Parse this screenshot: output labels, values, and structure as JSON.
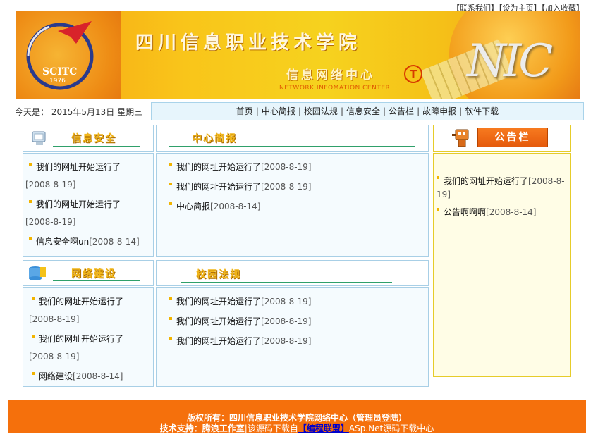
{
  "top_links": {
    "contact": "【联系我们】",
    "homepage": "【设为主页】",
    "favorite": "【加入收藏】"
  },
  "banner": {
    "title": "四川信息职业技术学院",
    "subtitle": "信息网络中心",
    "english": "NETWORK INFOMATION CENTER",
    "logo_text": "SCITC",
    "logo_year": "1976",
    "nic": "NIC",
    "t_mark": "T"
  },
  "date_bar": {
    "label": "今天是：",
    "date": "2015年5月13日 星期三"
  },
  "nav": {
    "items": [
      "首页",
      "中心简报",
      "校园法规",
      "信息安全",
      "公告栏",
      "故障申报",
      "软件下载"
    ],
    "separator": "|"
  },
  "panels": {
    "security": {
      "title": "信息安全",
      "items": [
        {
          "text": "我们的网址开始运行了",
          "date": "[2008-8-19]"
        },
        {
          "text": "我们的网址开始运行了",
          "date": "[2008-8-19]"
        },
        {
          "text": "信息安全啊un",
          "date": "[2008-8-14]"
        }
      ]
    },
    "briefing": {
      "title": "中心简报",
      "items": [
        {
          "text": "我们的网址开始运行了",
          "date": "[2008-8-19]"
        },
        {
          "text": "我们的网址开始运行了",
          "date": "[2008-8-19]"
        },
        {
          "text": "中心简报",
          "date": "[2008-8-14]"
        }
      ]
    },
    "network": {
      "title": "网络建设",
      "items": [
        {
          "text": "我们的网址开始运行了",
          "date": "[2008-8-19]"
        },
        {
          "text": "我们的网址开始运行了",
          "date": "[2008-8-19]"
        },
        {
          "text": "网络建设",
          "date": "[2008-8-14]"
        }
      ]
    },
    "regulations": {
      "title": "校园法规",
      "items": [
        {
          "text": "我们的网址开始运行了",
          "date": "[2008-8-19]"
        },
        {
          "text": "我们的网址开始运行了",
          "date": "[2008-8-19]"
        },
        {
          "text": "我们的网址开始运行了",
          "date": "[2008-8-19]"
        }
      ]
    }
  },
  "notice": {
    "title": "公告栏",
    "items": [
      {
        "text": "我们的网址开始运行了",
        "date": "[2008-8-19]"
      },
      {
        "text": "公告啊啊啊",
        "date": "[2008-8-14]"
      }
    ]
  },
  "footer": {
    "line1": "版权所有：四川信息职业技术学院网络中心（管理员登陆）",
    "support_label": "技术支持：腾浪工作室",
    "source_text": "该源码下载自",
    "source_link": "【编程联盟】",
    "source_tail": "ASp.Net源码下载中心"
  },
  "colors": {
    "accent_orange": "#f5700c",
    "panel_border": "#a8cfe6",
    "nav_bg": "#e7f5fc",
    "notice_bg": "#fffde6",
    "bullet": "#f2b400"
  }
}
